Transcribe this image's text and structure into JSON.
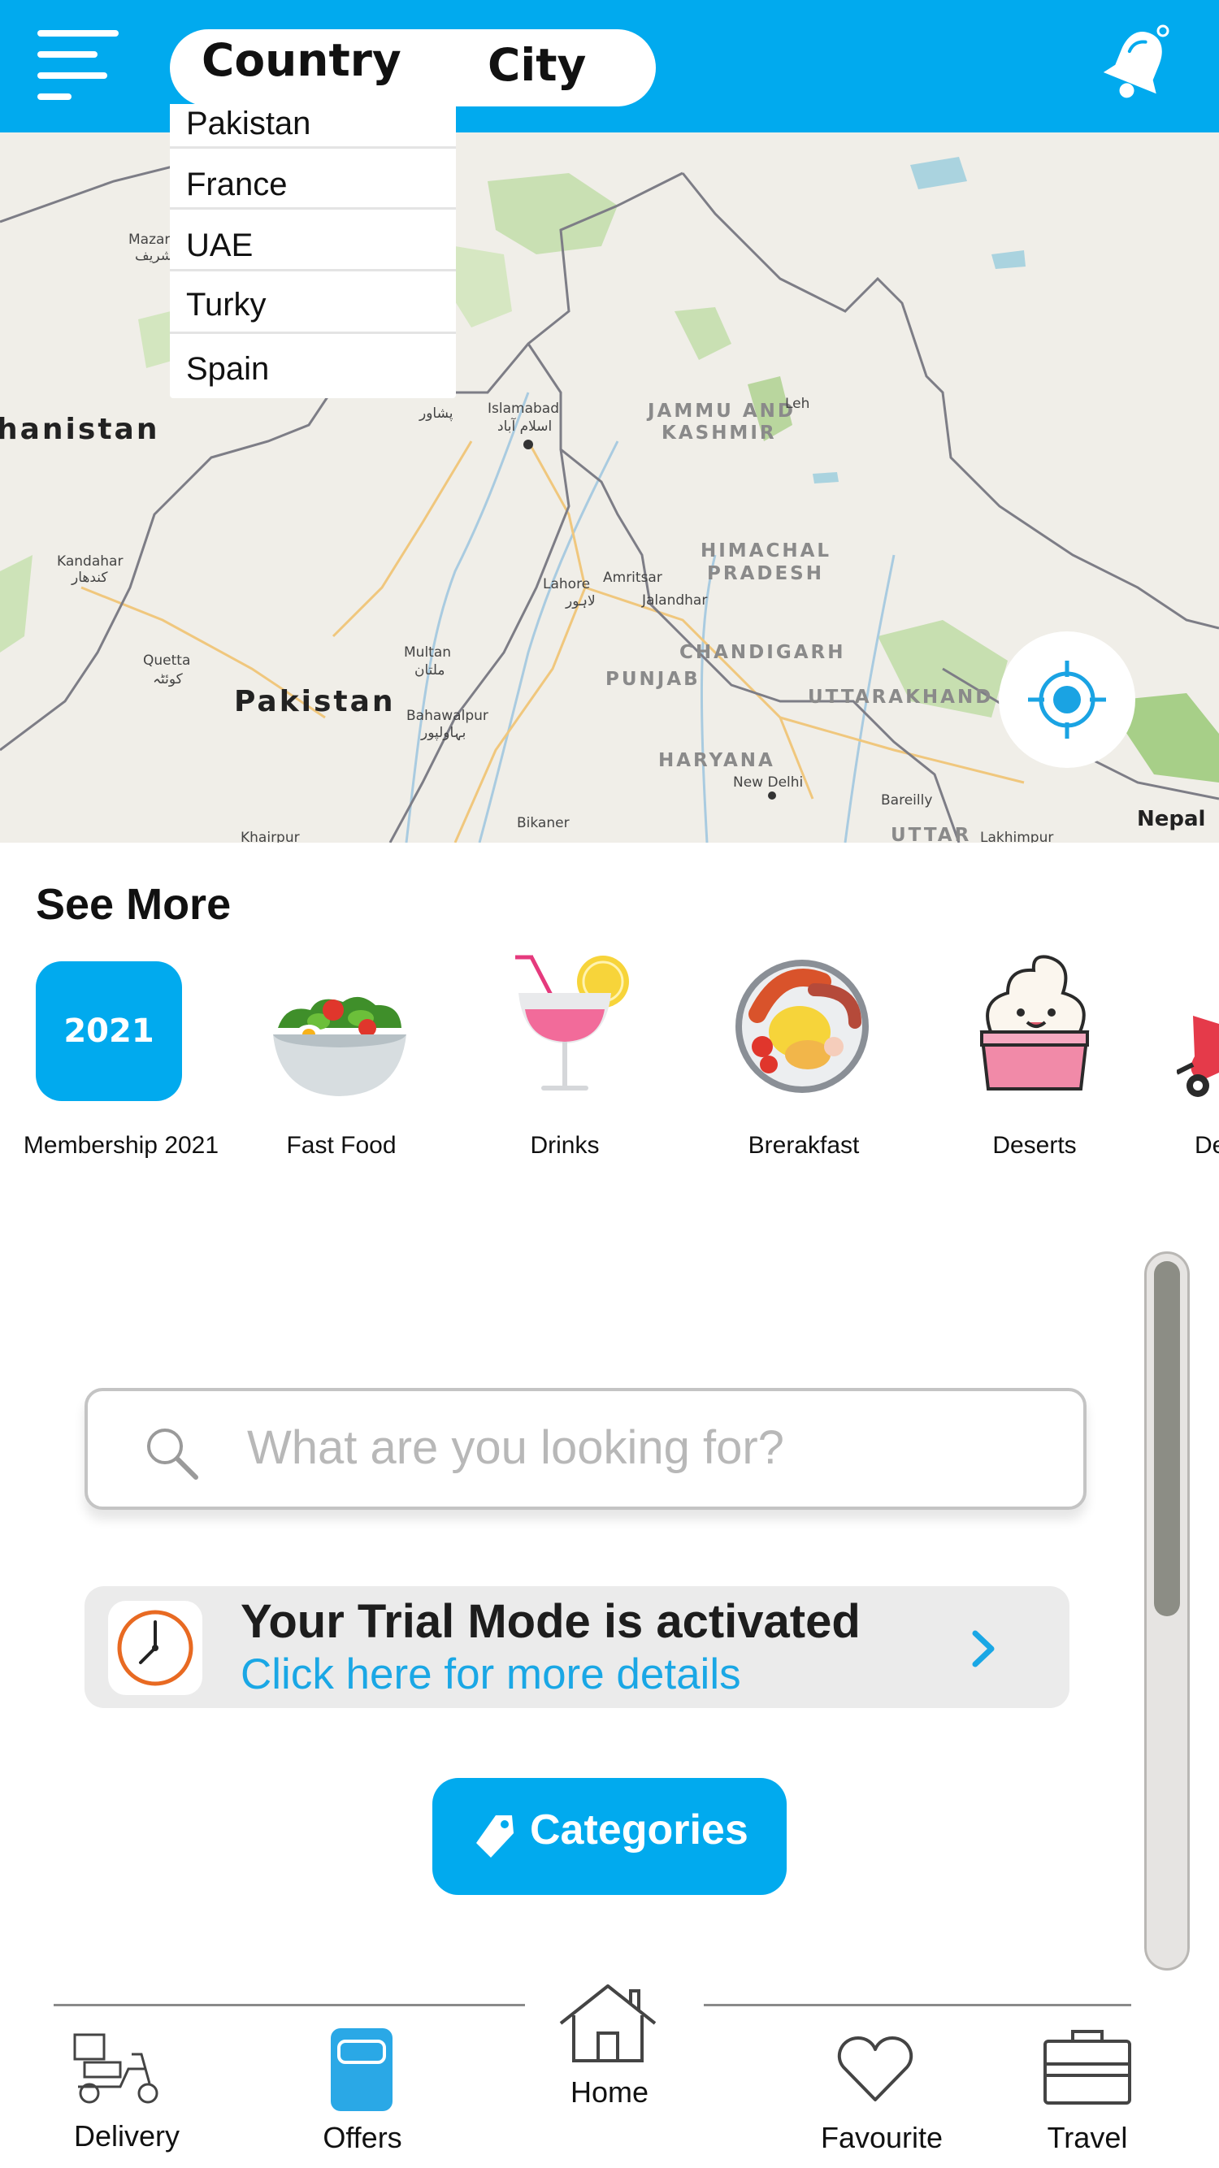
{
  "header": {
    "menu_icon": "hamburger-menu-icon",
    "tabs": [
      "Country",
      "City"
    ],
    "notification_icon": "bell-icon",
    "background": "#01aaee"
  },
  "country_dropdown": {
    "options": [
      "Pakistan",
      "France",
      "UAE",
      "Turky",
      "Spain"
    ]
  },
  "map": {
    "labels": {
      "afghanistan": "hanistan",
      "pakistan": "Pakistan",
      "jammu": "JAMMU AND",
      "kashmir": "KASHMIR",
      "himachal": "HIMACHAL",
      "pradesh": "PRADESH",
      "chandigarh": "CHANDIGARH",
      "punjab": "PUNJAB",
      "uttarakhand": "UTTARAKHAND",
      "haryana": "HARYANA",
      "uttar": "UTTAR",
      "nepal": "Nepal",
      "islamabad": "Islamabad",
      "islamabad_ur": "اسلام آباد",
      "peshawar": "پشاور",
      "leh": "Leh",
      "lahore": "Lahore",
      "lahore_ur": "لاہور",
      "amritsar": "Amritsar",
      "jalandhar": "Jalandhar",
      "multan": "Multan",
      "multan_ur": "ملتان",
      "bahawalpur": "Bahawalpur",
      "bahawalpur_ur": "بہاولپور",
      "kandahar": "Kandahar",
      "kandahar_ps": "کندهار",
      "quetta": "Quetta",
      "quetta_ur": "کوئٹہ",
      "mazar": "Mazar",
      "mazar_ps": "مزار شریف",
      "new_delhi": "New Delhi",
      "bikaner": "Bikaner",
      "bareilly": "Bareilly",
      "khairpur": "Khairpur",
      "lakhimpur": "Lakhimpur"
    },
    "locate_icon": "crosshair-location-icon"
  },
  "see_more": {
    "title": "See More",
    "items": [
      {
        "label": "Membership 2021",
        "badge": "2021"
      },
      {
        "label": "Fast Food",
        "icon": "salad-bowl-icon"
      },
      {
        "label": "Drinks",
        "icon": "cocktail-icon"
      },
      {
        "label": "Brerakfast",
        "icon": "breakfast-plate-icon"
      },
      {
        "label": "Deserts",
        "icon": "ice-cream-icon"
      },
      {
        "label": "De",
        "icon": "delivery-icon"
      }
    ]
  },
  "search": {
    "placeholder": "What are you looking for?"
  },
  "trial_banner": {
    "title": "Your Trial Mode is activated",
    "subtitle": "Click here for more details"
  },
  "categories_button": {
    "label": "Categories"
  },
  "bottom_nav": {
    "items": [
      {
        "label": "Delivery",
        "icon": "delivery-scooter-icon"
      },
      {
        "label": "Offers",
        "icon": "offers-icon"
      },
      {
        "label": "Home",
        "icon": "home-icon"
      },
      {
        "label": "Favourite",
        "icon": "heart-icon"
      },
      {
        "label": "Travel",
        "icon": "briefcase-icon"
      }
    ]
  },
  "colors": {
    "accent": "#01aaee",
    "link": "#1aa7e5",
    "banner_bg": "#ebebeb"
  }
}
